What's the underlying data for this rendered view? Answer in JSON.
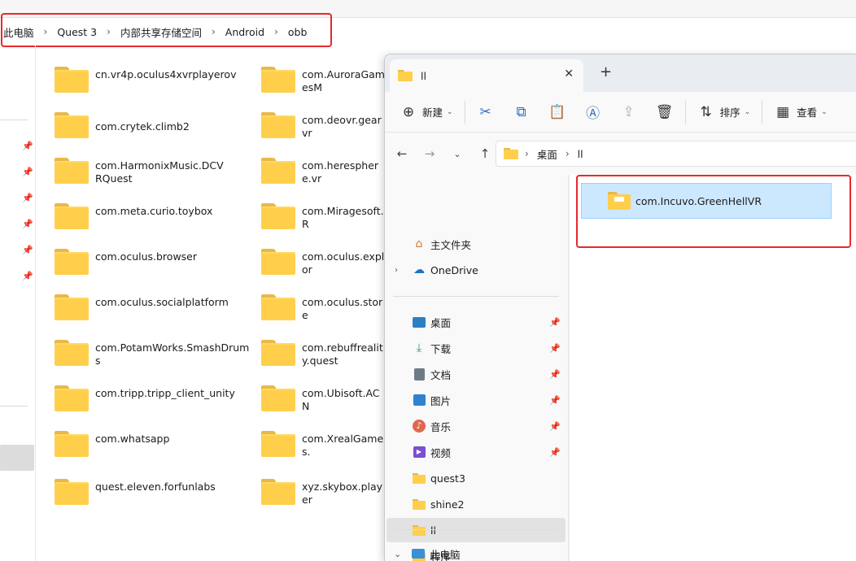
{
  "background": {
    "breadcrumb": [
      "此电脑",
      "Quest 3",
      "内部共享存储空间",
      "Android",
      "obb"
    ],
    "col1": [
      "cn.vr4p.oculus4xvrplayerov",
      "com.crytek.climb2",
      "com.HarmonixMusic.DCVRQuest",
      "com.meta.curio.toybox",
      "com.oculus.browser",
      "com.oculus.socialplatform",
      "com.PotamWorks.SmashDrums",
      "com.tripp.tripp_client_unity",
      "com.whatsapp",
      "quest.eleven.forfunlabs"
    ],
    "col2": [
      "com.AuroraGamesM",
      "com.deovr.gearvr",
      "com.heresphere.vr",
      "com.Miragesoft.R",
      "com.oculus.explor",
      "com.oculus.store",
      "com.rebuffreality.quest",
      "com.Ubisoft.ACN",
      "com.XrealGames.",
      "xyz.skybox.player"
    ]
  },
  "window": {
    "tab_title": "ll",
    "tab_close": "✕",
    "tab_new": "+",
    "toolbar": {
      "new_label": "新建",
      "sort_label": "排序",
      "view_label": "查看"
    },
    "address": {
      "crumbs": [
        "桌面",
        "ll"
      ]
    },
    "nav": {
      "home": "主文件夹",
      "onedrive": "OneDrive",
      "quick": [
        {
          "label": "桌面",
          "icon": "desktop-icon",
          "color": "#2b7fc4"
        },
        {
          "label": "下载",
          "icon": "download-icon",
          "color": "#1f9e5a"
        },
        {
          "label": "文档",
          "icon": "document-icon",
          "color": "#6f7a88"
        },
        {
          "label": "图片",
          "icon": "pictures-icon",
          "color": "#2f82d0"
        },
        {
          "label": "音乐",
          "icon": "music-icon",
          "color": "#e0684f"
        },
        {
          "label": "视频",
          "icon": "video-icon",
          "color": "#7b4fd1"
        }
      ],
      "folders": [
        "quest3",
        "shine2",
        "ll",
        "程序"
      ],
      "thispc": "此电脑"
    },
    "content": {
      "item": "com.Incuvo.GreenHellVR"
    }
  }
}
